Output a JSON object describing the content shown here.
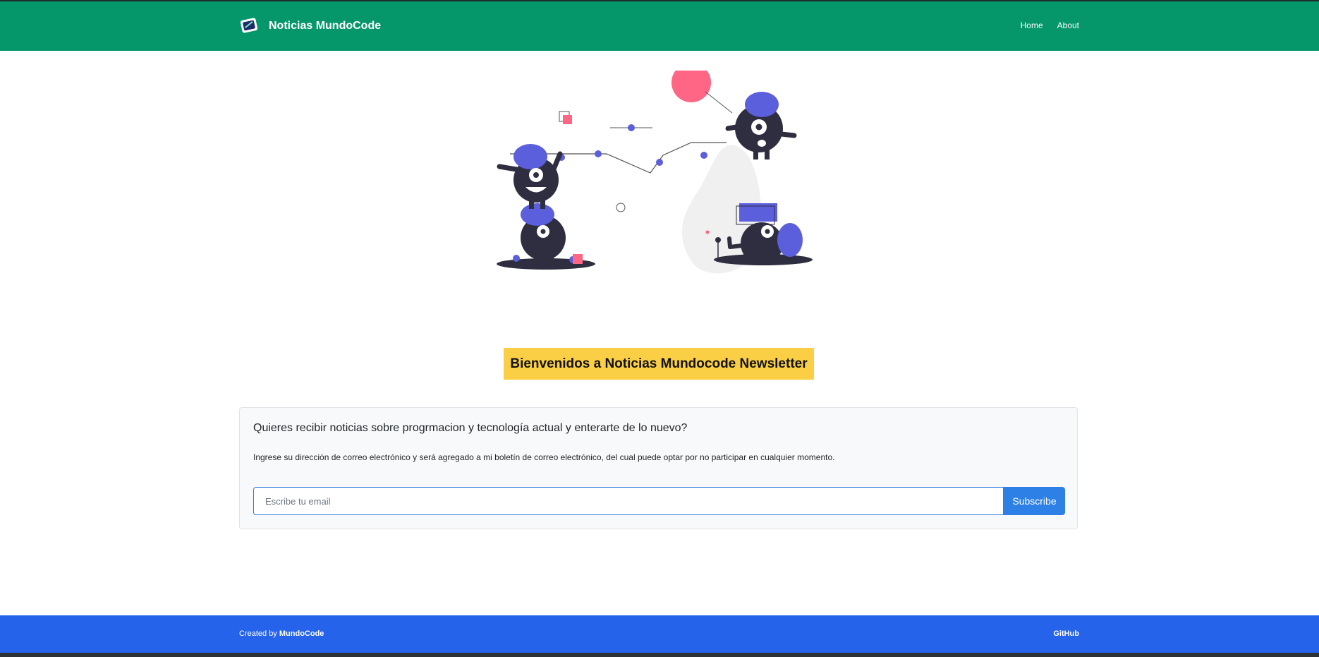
{
  "navbar": {
    "brand": "Noticias MundoCode",
    "links": [
      "Home",
      "About"
    ]
  },
  "hero": {
    "welcome": "Bienvenidos a Noticias Mundocode Newsletter"
  },
  "newsletter": {
    "heading": "Quieres recibir noticias sobre progrmacion y tecnología actual y enterarte de lo nuevo?",
    "description": "Ingrese su dirección de correo electrónico y será agregado a mi boletín de correo electrónico, del cual puede optar por no participar en cualquier momento.",
    "email_placeholder": "Escribe tu email",
    "subscribe_label": "Subscribe"
  },
  "footer": {
    "created_by": "Created by",
    "author": "MundoCode",
    "github": "GitHub"
  },
  "colors": {
    "navbar": "#059669",
    "footer": "#2563eb",
    "welcome_bg": "#fbcf45",
    "button": "#2d81e6"
  },
  "icons": {
    "brand": "newspaper-icon"
  }
}
